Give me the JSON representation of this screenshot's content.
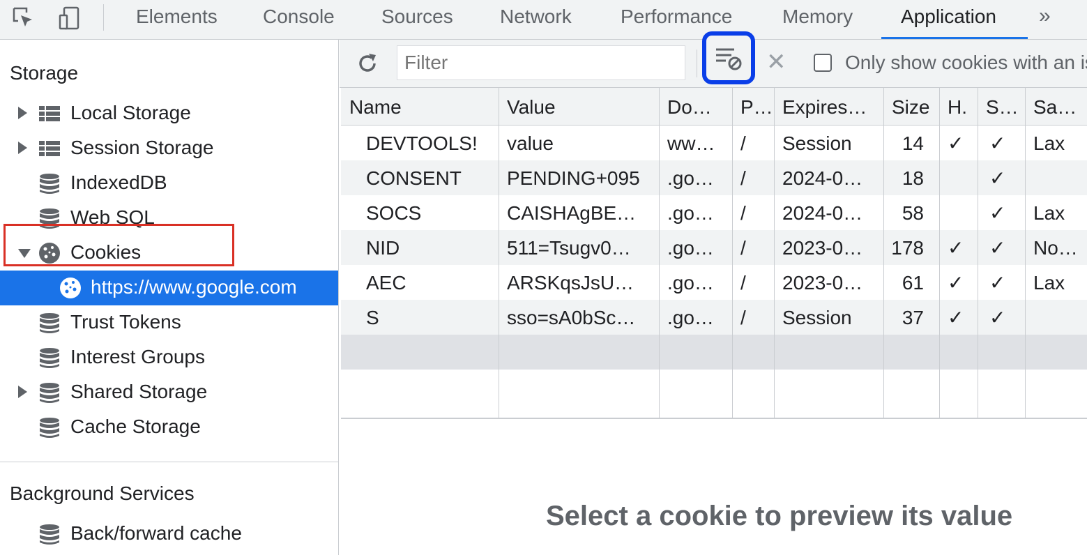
{
  "tabs": [
    "Elements",
    "Console",
    "Sources",
    "Network",
    "Performance",
    "Memory",
    "Application"
  ],
  "tabs_more": "»",
  "sidebar": {
    "storage_title": "Storage",
    "items": [
      {
        "label": "Local Storage",
        "icon": "grid-icon",
        "arrow": "right"
      },
      {
        "label": "Session Storage",
        "icon": "grid-icon",
        "arrow": "right"
      },
      {
        "label": "IndexedDB",
        "icon": "database-icon",
        "arrow": ""
      },
      {
        "label": "Web SQL",
        "icon": "database-icon",
        "arrow": ""
      },
      {
        "label": "Cookies",
        "icon": "cookie-icon",
        "arrow": "down"
      },
      {
        "label": "https://www.google.com",
        "icon": "cookie-icon",
        "arrow": ""
      },
      {
        "label": "Trust Tokens",
        "icon": "database-icon",
        "arrow": ""
      },
      {
        "label": "Interest Groups",
        "icon": "database-icon",
        "arrow": ""
      },
      {
        "label": "Shared Storage",
        "icon": "database-icon",
        "arrow": "right"
      },
      {
        "label": "Cache Storage",
        "icon": "database-icon",
        "arrow": ""
      }
    ],
    "background_title": "Background Services",
    "background_items": [
      {
        "label": "Back/forward cache",
        "icon": "database-icon"
      }
    ]
  },
  "toolbar": {
    "filter_placeholder": "Filter",
    "only_show_label": "Only show cookies with an issue",
    "clear_x": "✕"
  },
  "table": {
    "columns": [
      "Name",
      "Value",
      "Do…",
      "P…",
      "Expires…",
      "Size",
      "H.",
      "S…",
      "Sa…"
    ],
    "rows": [
      [
        "DEVTOOLS!",
        "value",
        "ww…",
        "/",
        "Session",
        "14",
        "✓",
        "✓",
        "Lax"
      ],
      [
        "CONSENT",
        "PENDING+095",
        ".go…",
        "/",
        "2024-0…",
        "18",
        "",
        "✓",
        ""
      ],
      [
        "SOCS",
        "CAISHAgBE…",
        ".go…",
        "/",
        "2024-0…",
        "58",
        "",
        "✓",
        "Lax"
      ],
      [
        "NID",
        "511=Tsugv0…",
        ".go…",
        "/",
        "2023-0…",
        "178",
        "✓",
        "✓",
        "No…"
      ],
      [
        "AEC",
        "ARSKqsJsU…",
        ".go…",
        "/",
        "2023-0…",
        "61",
        "✓",
        "✓",
        "Lax"
      ],
      [
        "S",
        "sso=sA0bSc…",
        ".go…",
        "/",
        "Session",
        "37",
        "✓",
        "✓",
        ""
      ]
    ]
  },
  "preview_text": "Select a cookie to preview its value",
  "colors": {
    "accent": "#1a73e8",
    "highlight_red": "#d93025",
    "highlight_blue": "#0a3ee8"
  }
}
